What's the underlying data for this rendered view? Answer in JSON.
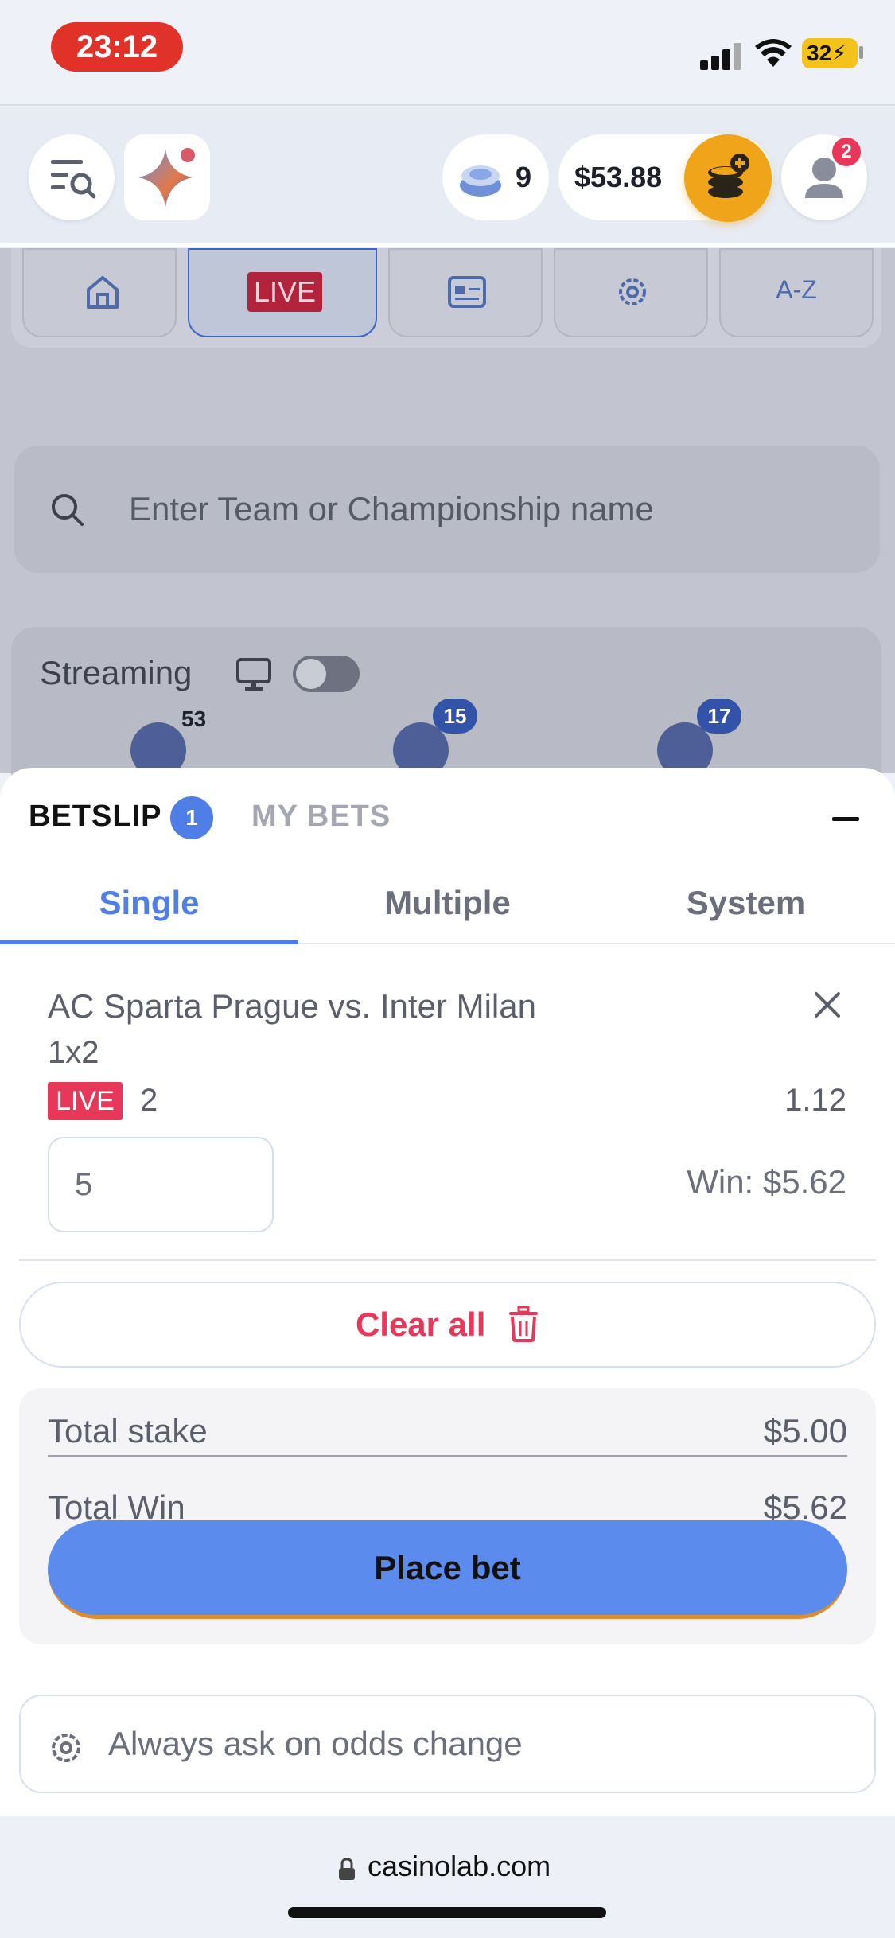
{
  "status_bar": {
    "time": "23:12",
    "battery": "32"
  },
  "header": {
    "gems_count": "9",
    "balance": "$53.88",
    "notifications_count": "2"
  },
  "nav": {
    "tabs": [
      {
        "name": "home",
        "icon": "home-icon"
      },
      {
        "name": "live",
        "label": "LIVE"
      },
      {
        "name": "tickets",
        "icon": "ticket-icon"
      },
      {
        "name": "settings",
        "icon": "gear-icon"
      },
      {
        "name": "az",
        "label": "A-Z"
      }
    ]
  },
  "search": {
    "placeholder": "Enter Team or Championship name"
  },
  "streaming": {
    "label": "Streaming",
    "sports": [
      {
        "name": "soccer",
        "count": "53"
      },
      {
        "name": "tennis",
        "count": "15"
      },
      {
        "name": "basketball",
        "count": "17"
      }
    ]
  },
  "betslip": {
    "title": "BETSLIP",
    "count": "1",
    "my_bets_label": "MY BETS",
    "tabs": [
      "Single",
      "Multiple",
      "System"
    ],
    "active_tab": "Single",
    "bet": {
      "match": "AC Sparta Prague vs. Inter Milan",
      "market": "1x2",
      "live_label": "LIVE",
      "selection": "2",
      "odds": "1.12",
      "stake": "5",
      "win_label": "Win: $5.62"
    },
    "clear_all_label": "Clear all",
    "total_stake_label": "Total stake",
    "total_stake_value": "$5.00",
    "total_win_label": "Total Win",
    "total_win_value": "$5.62",
    "place_bet_label": "Place bet",
    "odds_change_label": "Always ask on odds change"
  },
  "browser": {
    "url": "casinolab.com"
  },
  "colors": {
    "accent_blue": "#4f7fe6",
    "live_red": "#e8385a",
    "deposit_orange": "#f0a419"
  }
}
